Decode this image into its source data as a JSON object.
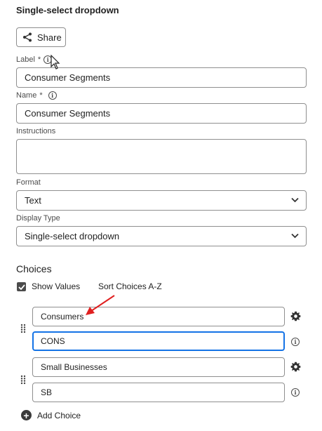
{
  "panel": {
    "title": "Single-select dropdown"
  },
  "share": {
    "label": "Share",
    "icon": "share-icon"
  },
  "label_field": {
    "label": "Label",
    "required": "*",
    "value": "Consumer Segments"
  },
  "name_field": {
    "label": "Name",
    "required": "*",
    "value": "Consumer Segments"
  },
  "instructions_field": {
    "label": "Instructions",
    "value": ""
  },
  "format_field": {
    "label": "Format",
    "value": "Text"
  },
  "display_type_field": {
    "label": "Display Type",
    "value": "Single-select dropdown"
  },
  "choices": {
    "title": "Choices",
    "show_values_label": "Show Values",
    "show_values_checked": true,
    "sort_label": "Sort Choices A-Z",
    "items": [
      {
        "label": "Consumers",
        "value": "CONS"
      },
      {
        "label": "Small Businesses",
        "value": "SB"
      }
    ],
    "add_label": "Add Choice"
  },
  "colors": {
    "focus": "#1473e6",
    "annotation_arrow": "#e02020"
  }
}
